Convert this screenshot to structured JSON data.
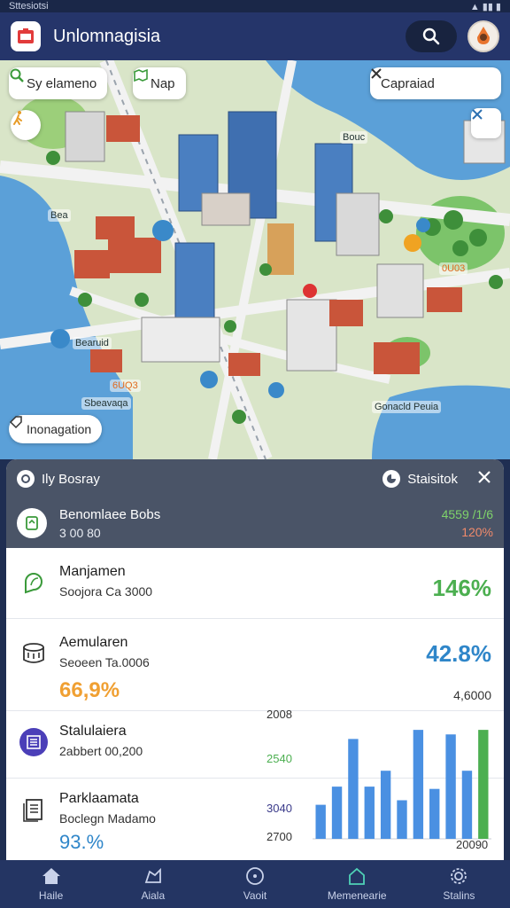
{
  "status_bar": {
    "left": "Sttesiotsi"
  },
  "app_bar": {
    "title": "Unlomnagisia"
  },
  "map": {
    "chip_search": "Sy elameno",
    "chip_map": "Nap",
    "search_box": "Capraiad",
    "chip_info": "Inonagation",
    "labels": [
      "Bea",
      "Bearuid",
      "Sbeavaqa",
      "Bouc",
      "Gonacld Peuia",
      "6UQ3",
      "0U03"
    ]
  },
  "panel": {
    "header_left": "Ily Bosray",
    "header_right": "Staisitok",
    "hero": {
      "title": "Benomlaee Bobs",
      "subtitle": "3 00 80",
      "value1": "4559 /1/6",
      "value2": "120%"
    },
    "rows": [
      {
        "title": "Manjamen",
        "subtitle": "Soojora Ca 3000",
        "value": "146%",
        "color": "#4caf50"
      },
      {
        "title": "Aemularen",
        "subtitle": "Seoeen Ta.0006",
        "value": "42.8%",
        "color": "#2f86c9",
        "extra": "66,9%",
        "extra_small": "4,6000"
      },
      {
        "title": "Stalulaiera",
        "subtitle": "2abbert 00,200"
      },
      {
        "title": "Parklaamata",
        "subtitle": "Boclegn Madamo",
        "extra": "93.%"
      }
    ]
  },
  "chart_data": {
    "type": "bar",
    "y_tick_labels": [
      "2008",
      "2540",
      "3040",
      "2700"
    ],
    "right_label": "20090",
    "values": [
      30,
      46,
      88,
      46,
      60,
      34,
      96,
      44,
      92,
      60,
      96
    ],
    "colors": [
      "#4a90e2",
      "#4a90e2",
      "#4a90e2",
      "#4a90e2",
      "#4a90e2",
      "#4a90e2",
      "#4a90e2",
      "#4a90e2",
      "#4a90e2",
      "#4a90e2",
      "#4caf50"
    ],
    "ylim": [
      0,
      100
    ]
  },
  "nav": {
    "items": [
      {
        "label": "Haile",
        "icon": "home-icon"
      },
      {
        "label": "Aiala",
        "icon": "map-icon"
      },
      {
        "label": "Vaoit",
        "icon": "compass-icon"
      },
      {
        "label": "Memenearie",
        "icon": "share-icon"
      },
      {
        "label": "Stalins",
        "icon": "settings-icon"
      }
    ]
  }
}
